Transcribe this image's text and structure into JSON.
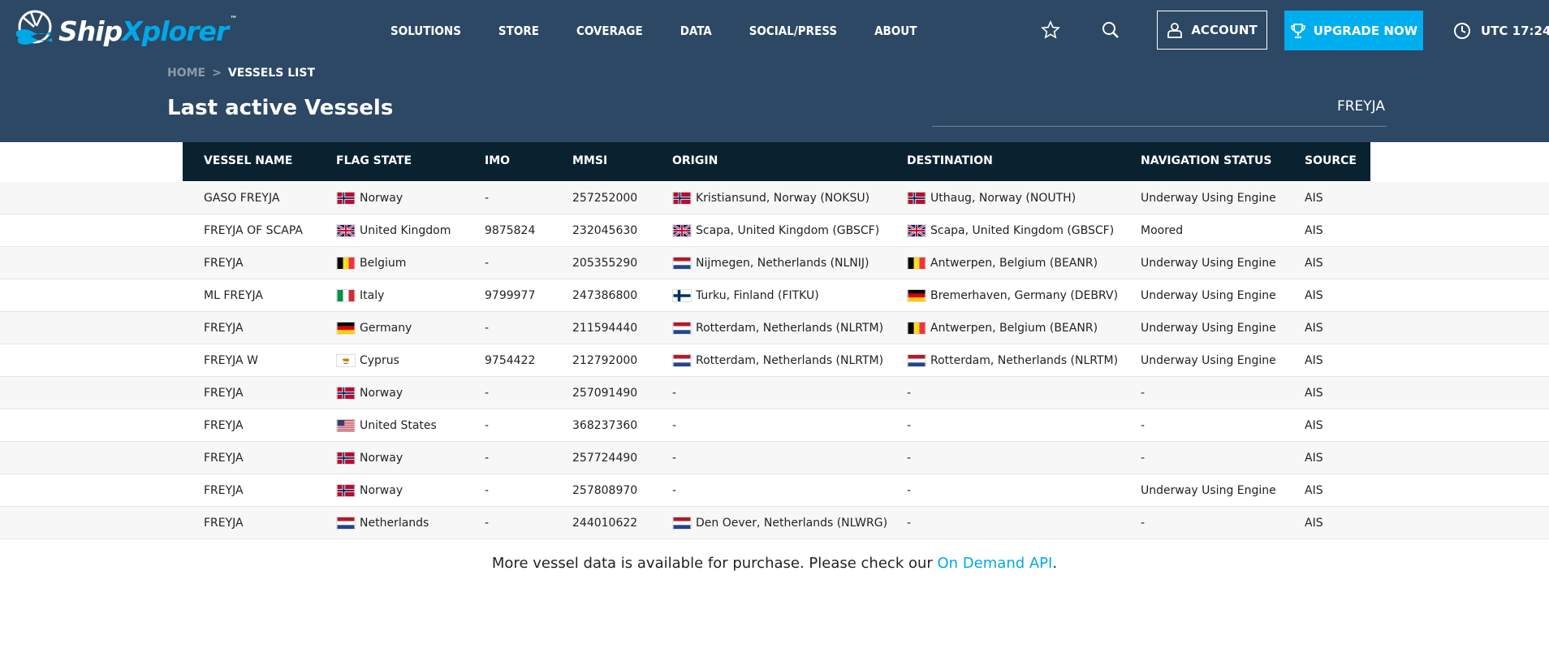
{
  "brand": {
    "name_part1": "Ship",
    "name_part2": "Xplorer",
    "tm": "™"
  },
  "nav": {
    "items": [
      "SOLUTIONS",
      "STORE",
      "COVERAGE",
      "DATA",
      "SOCIAL/PRESS",
      "ABOUT"
    ],
    "account_label": "ACCOUNT",
    "upgrade_label": "UPGRADE NOW",
    "utc_label": "UTC 17:24"
  },
  "breadcrumb": {
    "home": "HOME",
    "separator": ">",
    "current": "VESSELS LIST"
  },
  "page_title": "Last active Vessels",
  "search": {
    "value": "FREYJA"
  },
  "colors": {
    "header_bg": "#2c4864",
    "table_header_bg": "#0a2230",
    "accent": "#00aeef"
  },
  "table": {
    "columns": [
      "VESSEL NAME",
      "FLAG STATE",
      "IMO",
      "MMSI",
      "ORIGIN",
      "DESTINATION",
      "NAVIGATION STATUS",
      "SOURCE"
    ],
    "rows": [
      {
        "name": "GASO FREYJA",
        "flag": "Norway",
        "flag_icon": "no",
        "imo": "-",
        "mmsi": "257252000",
        "origin": "Kristiansund, Norway (NOKSU)",
        "origin_flag": "no",
        "destination": "Uthaug, Norway (NOUTH)",
        "destination_flag": "no",
        "status": "Underway Using Engine",
        "source": "AIS"
      },
      {
        "name": "FREYJA OF SCAPA",
        "flag": "United Kingdom",
        "flag_icon": "gb",
        "imo": "9875824",
        "mmsi": "232045630",
        "origin": "Scapa, United Kingdom (GBSCF)",
        "origin_flag": "gb",
        "destination": "Scapa, United Kingdom (GBSCF)",
        "destination_flag": "gb",
        "status": "Moored",
        "source": "AIS"
      },
      {
        "name": "FREYJA",
        "flag": "Belgium",
        "flag_icon": "be",
        "imo": "-",
        "mmsi": "205355290",
        "origin": "Nijmegen, Netherlands (NLNIJ)",
        "origin_flag": "nl",
        "destination": "Antwerpen, Belgium (BEANR)",
        "destination_flag": "be",
        "status": "Underway Using Engine",
        "source": "AIS"
      },
      {
        "name": "ML FREYJA",
        "flag": "Italy",
        "flag_icon": "it",
        "imo": "9799977",
        "mmsi": "247386800",
        "origin": "Turku, Finland (FITKU)",
        "origin_flag": "fi",
        "destination": "Bremerhaven, Germany (DEBRV)",
        "destination_flag": "de",
        "status": "Underway Using Engine",
        "source": "AIS"
      },
      {
        "name": "FREYJA",
        "flag": "Germany",
        "flag_icon": "de",
        "imo": "-",
        "mmsi": "211594440",
        "origin": "Rotterdam, Netherlands (NLRTM)",
        "origin_flag": "nl",
        "destination": "Antwerpen, Belgium (BEANR)",
        "destination_flag": "be",
        "status": "Underway Using Engine",
        "source": "AIS"
      },
      {
        "name": "FREYJA W",
        "flag": "Cyprus",
        "flag_icon": "cy",
        "imo": "9754422",
        "mmsi": "212792000",
        "origin": "Rotterdam, Netherlands (NLRTM)",
        "origin_flag": "nl",
        "destination": "Rotterdam, Netherlands (NLRTM)",
        "destination_flag": "nl",
        "status": "Underway Using Engine",
        "source": "AIS"
      },
      {
        "name": "FREYJA",
        "flag": "Norway",
        "flag_icon": "no",
        "imo": "-",
        "mmsi": "257091490",
        "origin": "-",
        "origin_flag": "",
        "destination": "-",
        "destination_flag": "",
        "status": "-",
        "source": "AIS"
      },
      {
        "name": "FREYJA",
        "flag": "United States",
        "flag_icon": "us",
        "imo": "-",
        "mmsi": "368237360",
        "origin": "-",
        "origin_flag": "",
        "destination": "-",
        "destination_flag": "",
        "status": "-",
        "source": "AIS"
      },
      {
        "name": "FREYJA",
        "flag": "Norway",
        "flag_icon": "no",
        "imo": "-",
        "mmsi": "257724490",
        "origin": "-",
        "origin_flag": "",
        "destination": "-",
        "destination_flag": "",
        "status": "-",
        "source": "AIS"
      },
      {
        "name": "FREYJA",
        "flag": "Norway",
        "flag_icon": "no",
        "imo": "-",
        "mmsi": "257808970",
        "origin": "-",
        "origin_flag": "",
        "destination": "-",
        "destination_flag": "",
        "status": "Underway Using Engine",
        "source": "AIS"
      },
      {
        "name": "FREYJA",
        "flag": "Netherlands",
        "flag_icon": "nl",
        "imo": "-",
        "mmsi": "244010622",
        "origin": "Den Oever, Netherlands (NLWRG)",
        "origin_flag": "nl",
        "destination": "-",
        "destination_flag": "",
        "status": "-",
        "source": "AIS"
      }
    ]
  },
  "footer": {
    "text": "More vessel data is available for purchase. Please check our ",
    "link": "On Demand API",
    "suffix": "."
  }
}
